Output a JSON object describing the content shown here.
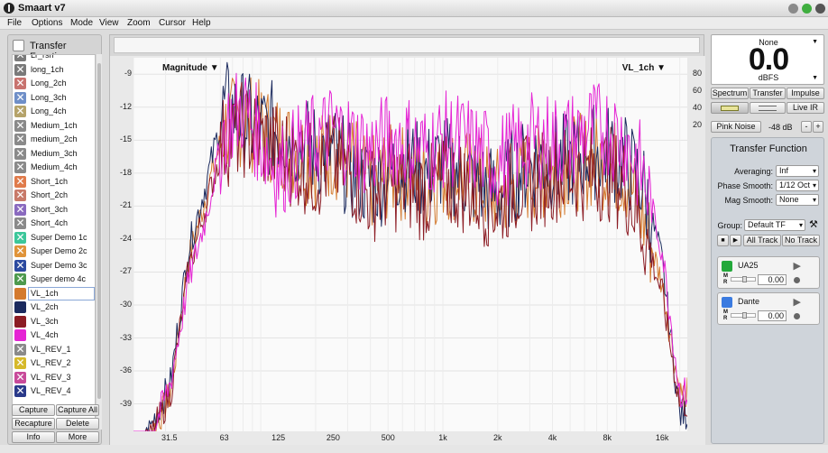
{
  "window": {
    "title": "Smaart v7"
  },
  "menu": [
    "File",
    "Options",
    "Mode",
    "View",
    "Zoom",
    "Cursor",
    "Help"
  ],
  "left_panel": {
    "title": "Transfer Function",
    "items": [
      {
        "label": "Lr_rsh",
        "color": "#7a7a7a",
        "type": "x"
      },
      {
        "label": "long_1ch",
        "color": "#7a7a7a",
        "type": "x"
      },
      {
        "label": "Long_2ch",
        "color": "#c8736f",
        "type": "x"
      },
      {
        "label": "Long_3ch",
        "color": "#6f8fc8",
        "type": "x"
      },
      {
        "label": "Long_4ch",
        "color": "#b5a36a",
        "type": "x"
      },
      {
        "label": "Medium_1ch",
        "color": "#8a8a8a",
        "type": "x"
      },
      {
        "label": "medium_2ch",
        "color": "#8a8a8a",
        "type": "x"
      },
      {
        "label": "Medium_3ch",
        "color": "#8a8a8a",
        "type": "x"
      },
      {
        "label": "Medium_4ch",
        "color": "#8a8a8a",
        "type": "x"
      },
      {
        "label": "Short_1ch",
        "color": "#e07b4b",
        "type": "x"
      },
      {
        "label": "Short_2ch",
        "color": "#c87a6a",
        "type": "x"
      },
      {
        "label": "Short_3ch",
        "color": "#8a6abf",
        "type": "x"
      },
      {
        "label": "Short_4ch",
        "color": "#8a8a8a",
        "type": "x"
      },
      {
        "label": "Super Demo 1c",
        "color": "#3cc79a",
        "type": "x"
      },
      {
        "label": "Super Demo 2c",
        "color": "#e0943a",
        "type": "x"
      },
      {
        "label": "Super Demo 3c",
        "color": "#2c4aa0",
        "type": "x"
      },
      {
        "label": "Super demo 4c",
        "color": "#4e9a4e",
        "type": "x"
      },
      {
        "label": "VL_1ch",
        "color": "#d47a2e",
        "type": "solid"
      },
      {
        "label": "VL_2ch",
        "color": "#1b2a5e",
        "type": "solid"
      },
      {
        "label": "VL_3ch",
        "color": "#8c1c24",
        "type": "solid"
      },
      {
        "label": "VL_4ch",
        "color": "#e524d4",
        "type": "solid"
      },
      {
        "label": "VL_REV_1",
        "color": "#8a8a8a",
        "type": "x"
      },
      {
        "label": "VL_REV_2",
        "color": "#d6b92a",
        "type": "x"
      },
      {
        "label": "VL_REV_3",
        "color": "#c84a9a",
        "type": "x"
      },
      {
        "label": "VL_REV_4",
        "color": "#2a3a8a",
        "type": "x"
      }
    ],
    "selected_index": 17,
    "buttons": {
      "capture": "Capture",
      "capture_all": "Capture All",
      "recapture": "Recapture",
      "delete": "Delete",
      "info": "Info",
      "more": "More"
    }
  },
  "plot": {
    "title_left": "Magnitude ▼",
    "title_right": "VL_1ch ▼",
    "y_ticks": [
      "-9",
      "-12",
      "-15",
      "-18",
      "-21",
      "-24",
      "-27",
      "-30",
      "-33",
      "-36",
      "-39"
    ],
    "y_right_ticks": [
      "80",
      "60",
      "40",
      "20"
    ],
    "x_ticks": [
      "31.5",
      "63",
      "125",
      "250",
      "500",
      "1k",
      "2k",
      "4k",
      "8k",
      "16k"
    ]
  },
  "chart_data": {
    "type": "line",
    "ylabel": "",
    "xlabel": "",
    "x_scale": "log",
    "ylim": [
      -41.5,
      -7.5
    ],
    "xlim": [
      20,
      22000
    ],
    "x": [
      20,
      25,
      32,
      40,
      50,
      63,
      80,
      100,
      125,
      160,
      200,
      250,
      315,
      400,
      500,
      630,
      800,
      1000,
      1250,
      1600,
      2000,
      2500,
      3150,
      4000,
      5000,
      6300,
      8000,
      10000,
      12500,
      16000,
      20000
    ],
    "series": [
      {
        "name": "VL_1ch",
        "color": "#d47a2e",
        "values": [
          -45,
          -42,
          -38,
          -26,
          -20,
          -14,
          -13,
          -14,
          -15,
          -16,
          -17,
          -16,
          -17,
          -19,
          -18,
          -18,
          -19,
          -18,
          -18,
          -19,
          -20,
          -19,
          -18,
          -18,
          -17,
          -17,
          -17,
          -18,
          -22,
          -28,
          -38
        ]
      },
      {
        "name": "VL_2ch",
        "color": "#1b2a5e",
        "values": [
          -45,
          -41,
          -37,
          -25,
          -19,
          -12,
          -13,
          -14,
          -14,
          -15,
          -16,
          -16,
          -18,
          -19,
          -18,
          -17,
          -18,
          -17,
          -18,
          -19,
          -20,
          -18,
          -17,
          -17,
          -17,
          -16,
          -16,
          -17,
          -19,
          -26,
          -40
        ]
      },
      {
        "name": "VL_3ch",
        "color": "#8c1c24",
        "values": [
          -45,
          -42,
          -38,
          -27,
          -21,
          -15,
          -14,
          -15,
          -16,
          -17,
          -18,
          -17,
          -18,
          -20,
          -19,
          -19,
          -20,
          -19,
          -19,
          -20,
          -21,
          -19,
          -19,
          -18,
          -18,
          -18,
          -18,
          -19,
          -23,
          -29,
          -39
        ]
      },
      {
        "name": "VL_4ch",
        "color": "#e524d4",
        "values": [
          -45,
          -42,
          -37,
          -28,
          -22,
          -14,
          -12,
          -15,
          -18,
          -16,
          -15,
          -14,
          -15,
          -16,
          -15,
          -15,
          -16,
          -15,
          -15,
          -16,
          -17,
          -16,
          -15,
          -15,
          -15,
          -14,
          -14,
          -15,
          -18,
          -25,
          -38
        ]
      }
    ]
  },
  "right_panel": {
    "meter": {
      "mode": "None",
      "value": "0.0",
      "unit": "dBFS"
    },
    "modes": [
      "Spectrum",
      "Transfer",
      "Impulse"
    ],
    "live_ir": "Live IR",
    "generator": {
      "label": "Pink Noise",
      "level": "-48 dB",
      "minus": "-",
      "plus": "+"
    },
    "tf": {
      "title": "Transfer Function",
      "averaging_label": "Averaging:",
      "averaging_value": "Inf",
      "phase_label": "Phase Smooth:",
      "phase_value": "1/12 Oct",
      "mag_label": "Mag Smooth:",
      "mag_value": "None",
      "group_label": "Group:",
      "group_value": "Default TF",
      "all_track": "All Track",
      "no_track": "No Track"
    },
    "channels": [
      {
        "name": "UA25",
        "color": "#22a83a",
        "mute": "M",
        "rec": "R",
        "gain": "0.00"
      },
      {
        "name": "Dante",
        "color": "#3b7be0",
        "mute": "M",
        "rec": "R",
        "gain": "0.00"
      }
    ]
  }
}
